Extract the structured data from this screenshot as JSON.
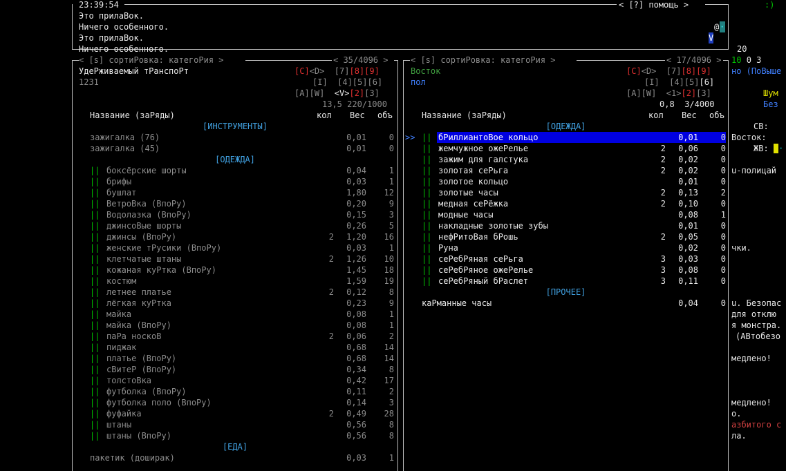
{
  "log": {
    "time": "23:39:54",
    "help": "< [?] помощь >",
    "lines": [
      "Это прилаВок.",
      "Ничего особенного.",
      "Это прилаВок.",
      "Ничего особенного."
    ],
    "sidebar": {
      "at": "@",
      "v": "V",
      "num": "20"
    }
  },
  "right_strip": {
    "smile": ":)",
    "stats": [
      "10",
      "0",
      "3"
    ],
    "lines": [
      "но (ПоВыше",
      "Шум",
      "Без",
      "СВ:",
      "Восток:",
      "ЖВ:",
      "u-полицай",
      "чки.",
      "u. Безопас",
      "для отклю",
      "я монстра.",
      "(АВтобезо",
      "медлено!",
      "медлено!",
      "о.",
      "азбитого с",
      "ла."
    ]
  },
  "left_pane": {
    "sort": "< [s] сортиРовка: категоРия >",
    "count": "< 35/4096 >",
    "title": "УдеРживаемый тРанспоРт",
    "subtitle": "1231",
    "keys_row1_red": "[C]",
    "keys_row1_rest": "<D>  [7]",
    "keys_row1_red2": "[8][9]",
    "keys_row2": "[I]  [4][5][6]",
    "keys_row3_a": "[A][W]  ",
    "keys_row3_v": "<V>",
    "keys_row3_red": "[2]",
    "keys_row3_end": "[3]",
    "weight": "13,5",
    "volume": "220/1000",
    "header": {
      "name": "Название (заРяды)",
      "qty": "кол",
      "weight": "Вес",
      "vol": "объ"
    },
    "rows": [
      {
        "cat": "[ИНСТРУМЕНТЫ]"
      },
      {
        "mark": "",
        "name": "зажигалка (76)",
        "qty": "",
        "w": "0,01",
        "v": "0"
      },
      {
        "mark": "",
        "name": "зажигалка (45)",
        "qty": "",
        "w": "0,01",
        "v": "0"
      },
      {
        "cat": "[ОДЕЖДА]"
      },
      {
        "mark": "||",
        "name": "боксёрские шорты",
        "qty": "",
        "w": "0,04",
        "v": "1"
      },
      {
        "mark": "||",
        "name": "брифы",
        "qty": "",
        "w": "0,03",
        "v": "1"
      },
      {
        "mark": "||",
        "name": "бушлат",
        "qty": "",
        "w": "1,80",
        "v": "12"
      },
      {
        "mark": "||",
        "name": "ВетроВка (ВпоРу)",
        "qty": "",
        "w": "0,20",
        "v": "9"
      },
      {
        "mark": "||",
        "name": "Водолазка (ВпоРу)",
        "qty": "",
        "w": "0,15",
        "v": "3"
      },
      {
        "mark": "||",
        "name": "джинсоВые шорты",
        "qty": "",
        "w": "0,26",
        "v": "5"
      },
      {
        "mark": "||",
        "name": "джинсы (ВпоРу)",
        "qty": "2",
        "w": "1,20",
        "v": "16"
      },
      {
        "mark": "||",
        "name": "женские тРусики (ВпоРу)",
        "qty": "",
        "w": "0,03",
        "v": "1"
      },
      {
        "mark": "||",
        "name": "клетчатые штаны",
        "qty": "2",
        "w": "1,26",
        "v": "10"
      },
      {
        "mark": "||",
        "name": "кожаная куРтка (ВпоРу)",
        "qty": "",
        "w": "1,45",
        "v": "18"
      },
      {
        "mark": "||",
        "name": "костюм",
        "qty": "",
        "w": "1,59",
        "v": "19"
      },
      {
        "mark": "||",
        "name": "летнее платье",
        "qty": "2",
        "w": "0,12",
        "v": "8"
      },
      {
        "mark": "||",
        "name": "лёгкая куРтка",
        "qty": "",
        "w": "0,23",
        "v": "9"
      },
      {
        "mark": "||",
        "name": "майка",
        "qty": "",
        "w": "0,08",
        "v": "1"
      },
      {
        "mark": "||",
        "name": "майка (ВпоРу)",
        "qty": "",
        "w": "0,08",
        "v": "1"
      },
      {
        "mark": "||",
        "name": "паРа носкоВ",
        "qty": "2",
        "w": "0,06",
        "v": "2"
      },
      {
        "mark": "||",
        "name": "пиджак",
        "qty": "",
        "w": "0,68",
        "v": "14"
      },
      {
        "mark": "||",
        "name": "платье (ВпоРу)",
        "qty": "",
        "w": "0,68",
        "v": "14"
      },
      {
        "mark": "||",
        "name": "сВитеР (ВпоРу)",
        "qty": "",
        "w": "0,34",
        "v": "8"
      },
      {
        "mark": "||",
        "name": "толстоВка",
        "qty": "",
        "w": "0,42",
        "v": "17"
      },
      {
        "mark": "||",
        "name": "футболка (ВпоРу)",
        "qty": "",
        "w": "0,11",
        "v": "2"
      },
      {
        "mark": "||",
        "name": "футболка поло (ВпоРу)",
        "qty": "",
        "w": "0,14",
        "v": "3"
      },
      {
        "mark": "||",
        "name": "фуфайка",
        "qty": "2",
        "w": "0,49",
        "v": "28"
      },
      {
        "mark": "||",
        "name": "штаны",
        "qty": "",
        "w": "0,56",
        "v": "8"
      },
      {
        "mark": "||",
        "name": "штаны (ВпоРу)",
        "qty": "",
        "w": "0,56",
        "v": "8"
      },
      {
        "cat": "[ЕДА]"
      },
      {
        "mark": "",
        "name": "пакетик (доширак)",
        "qty": "",
        "w": "0,03",
        "v": "1"
      }
    ]
  },
  "right_pane": {
    "sort": "< [s] сортиРовка: категоРия >",
    "count": "< 17/4096 >",
    "title": "Восток",
    "subtitle": "пол",
    "keys_row1_red": "[C]",
    "keys_row1_rest": "<D>  [7]",
    "keys_row1_red2": "[8][9]",
    "keys_row2": "[I]  [4][5]",
    "keys_row2_hl": "[6]",
    "keys_row3_a": "[A][W]  <1>",
    "keys_row3_red": "[2]",
    "keys_row3_end": "[3]",
    "weight": "0,8",
    "volume": "3/4000",
    "header": {
      "name": "Название (заРяды)",
      "qty": "кол",
      "weight": "Вес",
      "vol": "объ"
    },
    "rows": [
      {
        "cat": "[ОДЕЖДА]"
      },
      {
        "mark": "||",
        "name": "бРиллиантоВое кольцо",
        "qty": "",
        "w": "0,01",
        "v": "0",
        "selected": true,
        "cursor": ">>"
      },
      {
        "mark": "||",
        "name": "жемчужное ожеРелье",
        "qty": "2",
        "w": "0,06",
        "v": "0"
      },
      {
        "mark": "||",
        "name": "зажим для галстука",
        "qty": "2",
        "w": "0,02",
        "v": "0"
      },
      {
        "mark": "||",
        "name": "золотая сеРьга",
        "qty": "2",
        "w": "0,02",
        "v": "0"
      },
      {
        "mark": "||",
        "name": "золотое кольцо",
        "qty": "",
        "w": "0,01",
        "v": "0"
      },
      {
        "mark": "||",
        "name": "золотые часы",
        "qty": "2",
        "w": "0,13",
        "v": "2"
      },
      {
        "mark": "||",
        "name": "медная сеРёжка",
        "qty": "2",
        "w": "0,10",
        "v": "0"
      },
      {
        "mark": "||",
        "name": "модные часы",
        "qty": "",
        "w": "0,08",
        "v": "1"
      },
      {
        "mark": "||",
        "name": "накладные золотые зубы",
        "qty": "",
        "w": "0,01",
        "v": "0"
      },
      {
        "mark": "||",
        "name": "нефРитоВая бРошь",
        "qty": "2",
        "w": "0,05",
        "v": "0"
      },
      {
        "mark": "||",
        "name": "Руна",
        "qty": "",
        "w": "0,02",
        "v": "0"
      },
      {
        "mark": "||",
        "name": "сеРебРяная сеРьга",
        "qty": "3",
        "w": "0,03",
        "v": "0"
      },
      {
        "mark": "||",
        "name": "сеРебРяное ожеРелье",
        "qty": "3",
        "w": "0,08",
        "v": "0"
      },
      {
        "mark": "||",
        "name": "сеРебРяный бРаслет",
        "qty": "3",
        "w": "0,11",
        "v": "0"
      },
      {
        "cat": "[ПРОЧЕЕ]"
      },
      {
        "mark": "",
        "name": "каРманные часы",
        "qty": "",
        "w": "0,04",
        "v": "0"
      }
    ]
  }
}
